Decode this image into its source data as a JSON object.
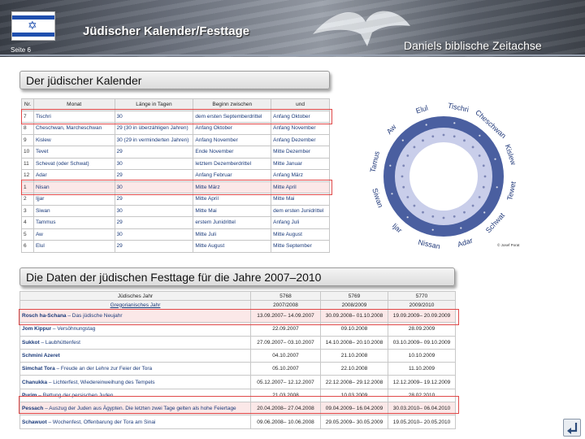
{
  "header": {
    "title": "Jüdischer Kalender/Festtage",
    "page_label": "Seite 6",
    "brand": "Daniels biblische Zeitachse"
  },
  "section1": {
    "heading": "Der jüdischer Kalender"
  },
  "month_table": {
    "columns": [
      "Nr.",
      "Monat",
      "Länge in Tagen",
      "Beginn zwischen",
      "und"
    ],
    "rows": [
      [
        "7",
        "Tischri",
        "30",
        "dem ersten Septemberdrittel",
        "Anfang Oktober"
      ],
      [
        "8",
        "Cheschwan, Marcheschwan",
        "29 (30 in überzähligen Jahren)",
        "Anfang Oktober",
        "Anfang November"
      ],
      [
        "9",
        "Kislew",
        "30 (29 in verminderten Jahren)",
        "Anfang November",
        "Anfang Dezember"
      ],
      [
        "10",
        "Tevet",
        "29",
        "Ende November",
        "Mitte Dezember"
      ],
      [
        "11",
        "Schevat (oder Schwat)",
        "30",
        "letztem Dezemberdrittel",
        "Mitte Januar"
      ],
      [
        "12",
        "Adar",
        "29",
        "Anfang Februar",
        "Anfang März"
      ],
      [
        "1",
        "Nisan",
        "30",
        "Mitte März",
        "Mitte April"
      ],
      [
        "2",
        "Ijjar",
        "29",
        "Mitte April",
        "Mitte Mai"
      ],
      [
        "3",
        "Siwan",
        "30",
        "Mitte Mai",
        "dem ersten Junidrittel"
      ],
      [
        "4",
        "Tammus",
        "29",
        "erstem Junidrittel",
        "Anfang Juli"
      ],
      [
        "5",
        "Aw",
        "30",
        "Mitte Juli",
        "Mitte August"
      ],
      [
        "6",
        "Elul",
        "29",
        "Mitte August",
        "Mitte September"
      ]
    ]
  },
  "wheel": {
    "months": [
      "Tischri",
      "Cheschwan",
      "Kislew",
      "Tewet",
      "Schwat",
      "Adar",
      "Nissan",
      "Ijar",
      "Siwan",
      "Tamus",
      "Aw",
      "Elul"
    ],
    "credit": "© Josef Porat",
    "colors": {
      "outer": "#4a5fa0",
      "middle": "#c9ceea",
      "inner": "#ffffff",
      "dots": "#dadde8"
    }
  },
  "section2": {
    "heading": "Die Daten der jüdischen Festtage für die Jahre 2007–2010"
  },
  "fest_table": {
    "header_row1": [
      "Jüdisches Jahr",
      "5768",
      "5769",
      "5770"
    ],
    "header_row2": [
      "Gregorianisches Jahr",
      "2007/2008",
      "2008/2009",
      "2009/2010"
    ],
    "rows": [
      {
        "name": "Rosch ha-Schana",
        "desc": " – Das jüdische Neujahr",
        "dates": [
          "13.09.2007– 14.09.2007",
          "30.09.2008– 01.10.2008",
          "19.09.2009– 20.09.2009"
        ],
        "highlight": true
      },
      {
        "name": "Jom Kippur",
        "desc": " – Versöhnungstag",
        "dates": [
          "22.09.2007",
          "09.10.2008",
          "28.09.2009"
        ],
        "highlight": false
      },
      {
        "name": "Sukkot",
        "desc": " – Laubhüttenfest",
        "dates": [
          "27.09.2007– 03.10.2007",
          "14.10.2008– 20.10.2008",
          "03.10.2009– 09.10.2009"
        ],
        "highlight": false
      },
      {
        "name": "Schmini Azeret",
        "desc": "",
        "dates": [
          "04.10.2007",
          "21.10.2008",
          "10.10.2009"
        ],
        "highlight": false
      },
      {
        "name": "Simchat Tora",
        "desc": " – Freude an der Lehre zur Feier der Tora",
        "dates": [
          "05.10.2007",
          "22.10.2008",
          "11.10.2009"
        ],
        "highlight": false
      },
      {
        "name": "Chanukka",
        "desc": " – Lichterfest, Wiedereinweihung des Tempels",
        "dates": [
          "05.12.2007– 12.12.2007",
          "22.12.2008– 29.12.2008",
          "12.12.2009– 19.12.2009"
        ],
        "highlight": false
      },
      {
        "name": "Purim",
        "desc": " – Rettung der persischen Juden",
        "dates": [
          "21.03.2008",
          "10.03.2009",
          "28.02.2010"
        ],
        "highlight": false
      },
      {
        "name": "Pessach",
        "desc": " – Auszug der Juden aus Ägypten. Die letzten zwei Tage gelten als hohe Feiertage",
        "dates": [
          "20.04.2008– 27.04.2008",
          "09.04.2009– 16.04.2009",
          "30.03.2010– 06.04.2010"
        ],
        "highlight": true
      },
      {
        "name": "Schawuot",
        "desc": " – Wochenfest, Offenbarung der Tora am Sinai",
        "dates": [
          "09.06.2008– 10.06.2008",
          "29.05.2009– 30.05.2009",
          "19.05.2010– 20.05.2010"
        ],
        "highlight": false
      }
    ]
  },
  "icons": {
    "return_button": "return-arrow-icon",
    "flag": "israel-flag-icon"
  }
}
